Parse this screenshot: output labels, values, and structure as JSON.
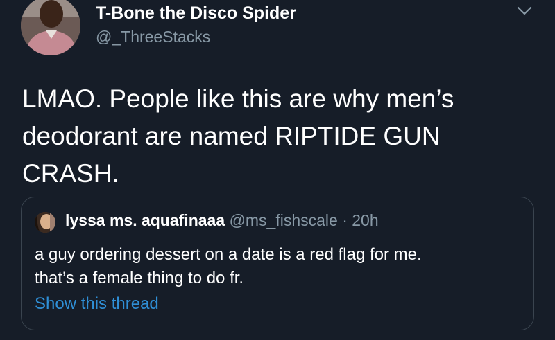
{
  "tweet": {
    "display_name": "T-Bone the Disco Spider",
    "handle": "@_ThreeStacks",
    "text_line1": "LMAO. People like this are why men’s",
    "text_line2": "deodorant are named RIPTIDE GUN",
    "text_line3": "CRASH.",
    "menu_icon": "chevron-down-icon"
  },
  "quoted": {
    "display_name": "lyssa ms. aquafinaaa",
    "handle": "@ms_fishscale",
    "separator": "·",
    "time": "20h",
    "text_line1": "a guy ordering dessert on a date is a red flag for me.",
    "text_line2": "that’s a female thing to do fr.",
    "show_thread": "Show this thread"
  },
  "colors": {
    "background": "#161d28",
    "secondary_text": "#8899a6",
    "link": "#2f8fd6",
    "border": "#3a444f"
  }
}
